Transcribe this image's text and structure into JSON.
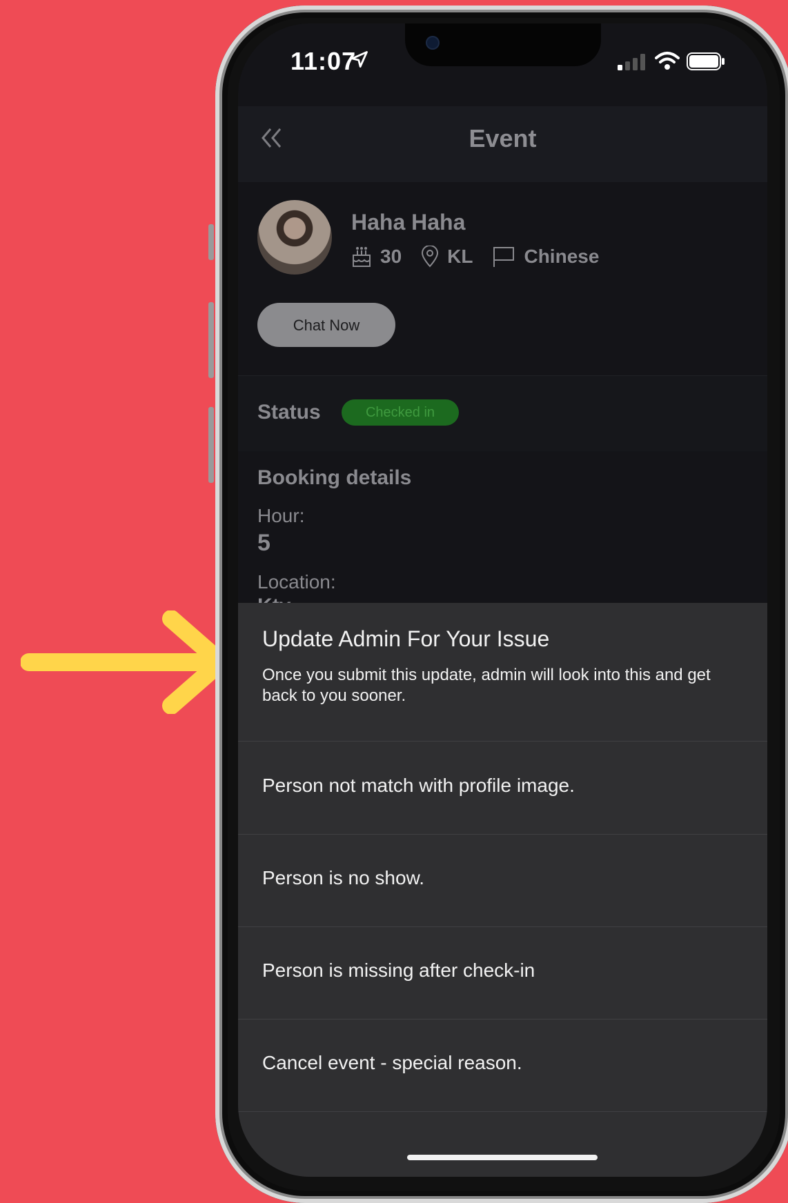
{
  "status_bar": {
    "time": "11:07"
  },
  "header": {
    "back_icon": "double-chevron-left-icon",
    "title": "Event"
  },
  "profile": {
    "name": "Haha Haha",
    "age": "30",
    "location": "KL",
    "language": "Chinese",
    "chat_button": "Chat Now"
  },
  "status": {
    "label": "Status",
    "badge": "Checked in"
  },
  "booking": {
    "title": "Booking details",
    "hour_label": "Hour:",
    "hour_value": "5",
    "location_label": "Location:",
    "location_value": "Ktv"
  },
  "sheet": {
    "title": "Update Admin For Your Issue",
    "subtitle": "Once you submit this update, admin will look into this and get back to you sooner.",
    "options": [
      "Person not match with profile image.",
      "Person is no show.",
      "Person is missing after check-in",
      "Cancel event - special reason."
    ]
  },
  "colors": {
    "background": "#ef4b55",
    "arrow": "#ffd54a",
    "badge": "#1c6a1f",
    "sheet": "#2f2f31"
  }
}
